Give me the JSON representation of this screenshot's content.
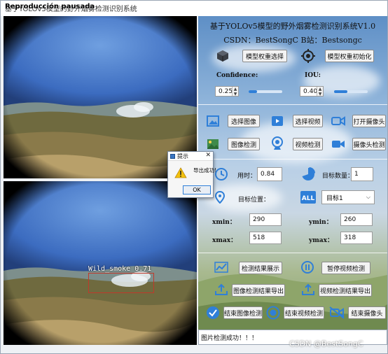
{
  "window": {
    "title": "基于YOLOv5模型的野外烟雾检测识别系统",
    "title_overlay": "Reproducción pausada"
  },
  "header": {
    "title": "基于YOLOv5模型的野外烟雾检测识别系统V1.0",
    "subtitle": "CSDN：BestSongC   B站：Bestsongc"
  },
  "model": {
    "select_label": "模型权重选择",
    "init_label": "模型权重初始化"
  },
  "confidence": {
    "label": "Confidence:",
    "value": "0.25",
    "level": 0.25
  },
  "iou": {
    "label": "IOU:",
    "value": "0.40",
    "level": 0.4
  },
  "media": {
    "select_image": "选择图像",
    "select_video": "选择视频",
    "open_camera": "打开摄像头",
    "image_detect": "图像检测",
    "video_detect": "视频检测",
    "camera_detect": "摄像头检测"
  },
  "stats": {
    "time_label": "用时：",
    "time_value": "0.84",
    "count_label": "目标数量：",
    "count_value": "1",
    "position_label": "目标位置：",
    "target_select": "目标1",
    "xmin_label": "xmin：",
    "xmin_value": "290",
    "ymin_label": "ymin：",
    "ymin_value": "260",
    "xmax_label": "xmax：",
    "xmax_value": "518",
    "ymax_label": "ymax：",
    "ymax_value": "318"
  },
  "actions": {
    "show_results": "检测结果展示",
    "pause_video": "暂停视频检测",
    "export_image": "图像检测结果导出",
    "export_video": "视频检测结果导出",
    "end_image": "结束图像检测",
    "end_video": "结束视频检测",
    "end_camera": "结束摄像头"
  },
  "status": {
    "text": "图片检测成功！！！"
  },
  "watermark": "CSDN @BestSongC",
  "detection": {
    "label": "Wild_smoke 0.71"
  },
  "dialog": {
    "title": "提示",
    "message": "导出成功!",
    "ok": "OK"
  },
  "colors": {
    "accent": "#2f7fd8",
    "bbox": "#c0392b"
  }
}
